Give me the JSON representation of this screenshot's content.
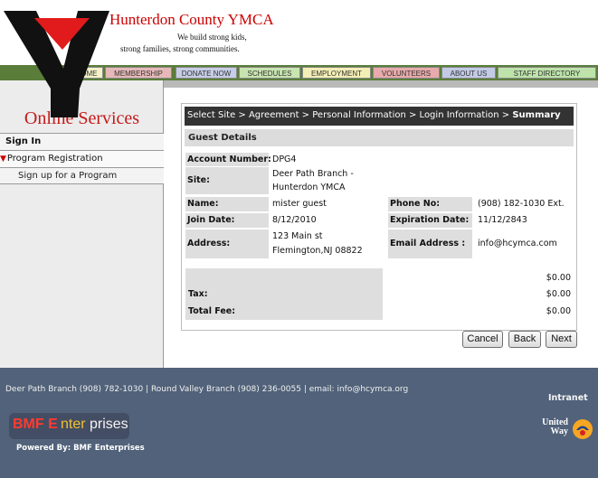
{
  "header": {
    "org_name": "Hunterdon County YMCA",
    "tagline_line1": "We build strong kids,",
    "tagline_line2": "strong families, strong communities."
  },
  "nav": {
    "items": [
      {
        "label": "HOME",
        "color": "#f4f1c8"
      },
      {
        "label": "MEMBERSHIP",
        "color": "#e6b8b8"
      },
      {
        "label": "DONATE NOW",
        "color": "#c6cde6"
      },
      {
        "label": "SCHEDULES",
        "color": "#c8e4b0"
      },
      {
        "label": "EMPLOYMENT",
        "color": "#f3eeb5"
      },
      {
        "label": "VOLUNTEERS",
        "color": "#e8aaaa"
      },
      {
        "label": "ABOUT US",
        "color": "#c2cae6"
      },
      {
        "label": "STAFF DIRECTORY",
        "color": "#bde3aa"
      }
    ]
  },
  "sidebar": {
    "title": "Online Services",
    "sign_in": "Sign In",
    "program_registration": "Program Registration",
    "sign_up": "Sign up for a Program"
  },
  "steps": {
    "prefix": "Select Site > Agreement > Personal Information > Login Information > ",
    "current": "Summary"
  },
  "guest": {
    "header": "Guest Details",
    "account_label": "Account Number:",
    "account_value": "DPG4",
    "site_label": "Site:",
    "site_value_line1": "Deer Path Branch -",
    "site_value_line2": "Hunterdon YMCA",
    "name_label": "Name:",
    "name_value": "mister guest",
    "phone_label": "Phone No:",
    "phone_value": "(908) 182-1030 Ext.",
    "join_label": "Join Date:",
    "join_value": "8/12/2010",
    "expiration_label": "Expiration Date:",
    "expiration_value": "11/12/2843",
    "address_label": "Address:",
    "address_line1": "123 Main st",
    "address_line2": "Flemington,NJ 08822",
    "email_label": "Email Address :",
    "email_value": "info@hcymca.com"
  },
  "fees": {
    "subtotal_value": "$0.00",
    "tax_label": "Tax:",
    "tax_value": "$0.00",
    "total_label": "Total Fee:",
    "total_value": "$0.00"
  },
  "buttons": {
    "cancel": "Cancel",
    "back": "Back",
    "next": "Next"
  },
  "footer": {
    "contact_line": "Deer Path Branch (908) 782-1030   |   Round Valley Branch (908) 236-0055   |   email: info@hcymca.org",
    "intranet": "Intranet",
    "bmf_part1": "BMF E",
    "bmf_part2": "nter",
    "bmf_part3": "prises",
    "powered_by": "Powered By: BMF Enterprises",
    "united_way_line1": "United",
    "united_way_line2": "Way"
  },
  "colors": {
    "ymca_red": "#cc0000",
    "nav_green": "#5a7d3a",
    "footer_blue": "#51627a"
  }
}
